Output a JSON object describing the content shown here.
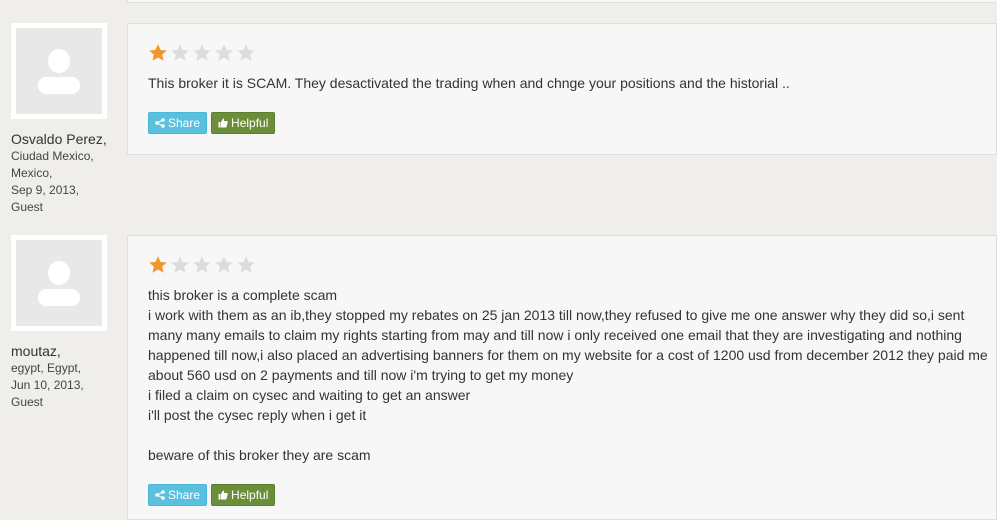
{
  "reviews": [
    {
      "author": {
        "name": "Osvaldo Perez,",
        "city": "Ciudad Mexico,",
        "country": "Mexico,",
        "date": "Sep 9, 2013,",
        "role": "Guest"
      },
      "rating": 1,
      "rating_max": 5,
      "text": "This broker it is SCAM. They desactivated the trading when and chnge your positions and the historial ..",
      "share_label": "Share",
      "helpful_label": "Helpful"
    },
    {
      "author": {
        "name": "moutaz,",
        "city": "egypt, Egypt,",
        "date": "Jun 10, 2013,",
        "role": "Guest"
      },
      "rating": 1,
      "rating_max": 5,
      "text": "this broker is a complete scam\ni work with them as an ib,they stopped my rebates on 25 jan 2013 till now,they refused to give me one answer why they did so,i sent many many emails to claim my rights starting from may and till now i only received one email that they are investigating and nothing happened till now,i also placed an advertising banners for them on my website for a cost of 1200 usd from december 2012 they paid me about 560 usd on 2 payments and till now i'm trying to get my money\ni filed a claim on cysec and waiting to get an answer\ni'll post the cysec reply when i get it\n\nbeware of this broker they are scam",
      "share_label": "Share",
      "helpful_label": "Helpful"
    }
  ],
  "colors": {
    "star_filled": "#f0962d",
    "star_empty": "#dcdcdc",
    "share_button": "#5bc0de",
    "helpful_button": "#6b8e3a"
  }
}
